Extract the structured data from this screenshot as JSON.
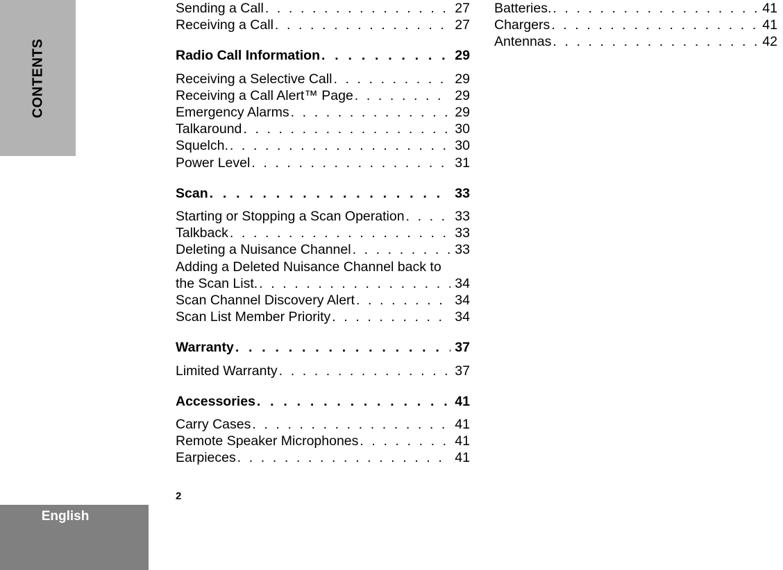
{
  "side_tab": {
    "label": "CONTENTS"
  },
  "footer": {
    "language_label": "English",
    "page_number": "2"
  },
  "colors": {
    "side_tab_background": "#b3b3b3",
    "language_band_background": "#808080",
    "language_band_text": "#ffffff",
    "text": "#000000",
    "page_background": "#ffffff"
  },
  "leader": {
    "dots": ". . . . . . . . . . . . . . . . . . . . . . . . . . . . . . . . . . . . . . . . . . . . . . . . . . . . ."
  },
  "columns": {
    "left": [
      {
        "kind": "entry",
        "title": "Sending a Call",
        "page": "27"
      },
      {
        "kind": "entry",
        "title": "Receiving a Call",
        "page": "27"
      },
      {
        "kind": "gap_before_section"
      },
      {
        "kind": "section",
        "title": "Radio Call Information",
        "page": "29"
      },
      {
        "kind": "gap_after_section"
      },
      {
        "kind": "entry",
        "title": "Receiving a Selective Call",
        "page": "29"
      },
      {
        "kind": "entry",
        "title": "Receiving a Call Alert™ Page",
        "page": "29"
      },
      {
        "kind": "entry",
        "title": "Emergency Alarms",
        "page": "29"
      },
      {
        "kind": "entry",
        "title": "Talkaround",
        "page": "30"
      },
      {
        "kind": "entry",
        "title": "Squelch.",
        "page": "30"
      },
      {
        "kind": "entry",
        "title": "Power Level",
        "page": "31"
      },
      {
        "kind": "gap_before_section"
      },
      {
        "kind": "section",
        "title": "Scan",
        "page": "33"
      },
      {
        "kind": "gap_after_section"
      },
      {
        "kind": "entry",
        "title": "Starting or Stopping a Scan Operation",
        "page": "33"
      },
      {
        "kind": "entry",
        "title": "Talkback",
        "page": "33"
      },
      {
        "kind": "entry",
        "title": "Deleting a Nuisance Channel",
        "page": "33"
      },
      {
        "kind": "wrapped",
        "title_line1": "Adding a Deleted Nuisance Channel back to",
        "title_line2": "the Scan List.",
        "page": "34"
      },
      {
        "kind": "entry",
        "title": "Scan Channel Discovery Alert",
        "page": "34"
      },
      {
        "kind": "entry",
        "title": "Scan List Member Priority",
        "page": "34"
      },
      {
        "kind": "gap_before_section"
      },
      {
        "kind": "section",
        "title": "Warranty",
        "page": "37"
      },
      {
        "kind": "gap_after_section"
      },
      {
        "kind": "entry",
        "title": "Limited Warranty",
        "page": "37"
      },
      {
        "kind": "gap_before_section"
      },
      {
        "kind": "section",
        "title": "Accessories",
        "page": "41"
      },
      {
        "kind": "gap_after_section"
      },
      {
        "kind": "entry",
        "title": "Carry Cases",
        "page": "41"
      },
      {
        "kind": "entry",
        "title": "Remote Speaker Microphones",
        "page": "41"
      },
      {
        "kind": "entry",
        "title": "Earpieces",
        "page": "41"
      }
    ],
    "right": [
      {
        "kind": "entry",
        "title": "Batteries.",
        "page": "41"
      },
      {
        "kind": "entry",
        "title": "Chargers",
        "page": "41"
      },
      {
        "kind": "entry",
        "title": "Antennas",
        "page": "42"
      }
    ]
  }
}
